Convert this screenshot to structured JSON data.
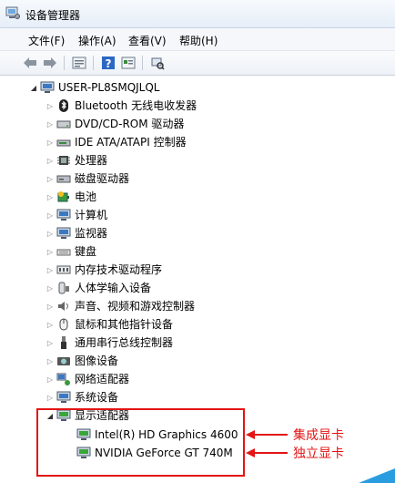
{
  "window": {
    "title": "设备管理器",
    "icon": "device-manager-icon"
  },
  "menu": [
    "文件(F)",
    "操作(A)",
    "查看(V)",
    "帮助(H)"
  ],
  "toolbar": [
    "back-arrow-icon",
    "forward-arrow-icon",
    "properties-icon",
    "help-icon",
    "show-hidden-icon",
    "scan-hardware-icon"
  ],
  "tree": {
    "root": "USER-PL8SMQJLQL",
    "categories": [
      {
        "label": "Bluetooth 无线电收发器",
        "icon": "bluetooth-icon"
      },
      {
        "label": "DVD/CD-ROM 驱动器",
        "icon": "dvd-drive-icon"
      },
      {
        "label": "IDE ATA/ATAPI 控制器",
        "icon": "ide-controller-icon"
      },
      {
        "label": "处理器",
        "icon": "processor-icon"
      },
      {
        "label": "磁盘驱动器",
        "icon": "disk-drive-icon"
      },
      {
        "label": "电池",
        "icon": "battery-icon"
      },
      {
        "label": "计算机",
        "icon": "computer-icon"
      },
      {
        "label": "监视器",
        "icon": "monitor-icon"
      },
      {
        "label": "键盘",
        "icon": "keyboard-icon"
      },
      {
        "label": "内存技术驱动程序",
        "icon": "memory-icon"
      },
      {
        "label": "人体学输入设备",
        "icon": "hid-icon"
      },
      {
        "label": "声音、视频和游戏控制器",
        "icon": "sound-icon"
      },
      {
        "label": "鼠标和其他指针设备",
        "icon": "mouse-icon"
      },
      {
        "label": "通用串行总线控制器",
        "icon": "usb-icon"
      },
      {
        "label": "图像设备",
        "icon": "imaging-icon"
      },
      {
        "label": "网络适配器",
        "icon": "network-adapter-icon"
      },
      {
        "label": "系统设备",
        "icon": "system-devices-icon"
      }
    ],
    "display": {
      "label": "显示适配器",
      "children": [
        "Intel(R) HD Graphics 4600",
        "NVIDIA GeForce GT 740M"
      ]
    }
  },
  "annotations": [
    "集成显卡",
    "独立显卡"
  ],
  "colors": {
    "annotation": "#e31414",
    "accent": "#2a9de0"
  }
}
